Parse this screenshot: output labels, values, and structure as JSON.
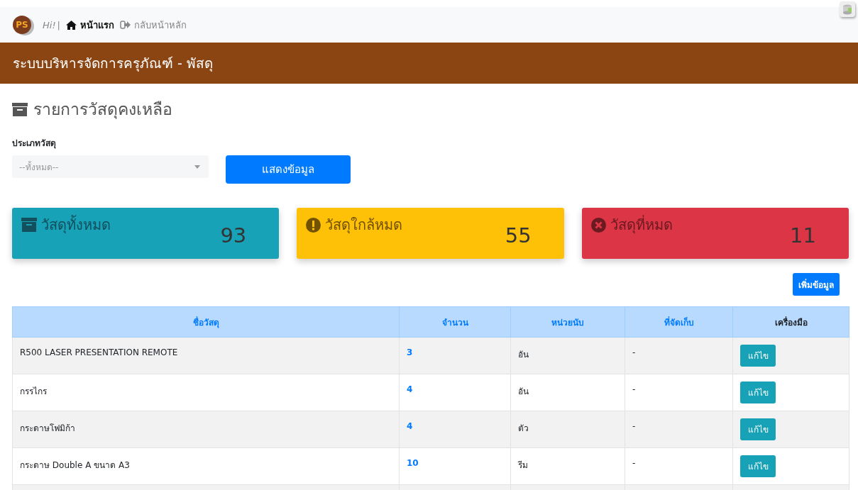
{
  "topbar": {
    "avatar": "PS",
    "greeting": "Hi!",
    "separator": "|",
    "links": [
      {
        "label": "หน้าแรก",
        "kind": "home",
        "bold": true
      },
      {
        "label": "กลับหน้าหลัก",
        "kind": "back",
        "bold": false
      }
    ]
  },
  "banner": {
    "title": "ระบบบริหารจัดการครุภัณฑ์ - พัสดุ"
  },
  "page_title": "รายการวัสดุคงเหลือ",
  "filter": {
    "label": "ประเภทวัสดุ",
    "placeholder": "--ทั้งหมด--",
    "button": "แสดงข้อมูล"
  },
  "cards": [
    {
      "kind": "info",
      "label": "วัสดุทั้งหมด",
      "count": "93"
    },
    {
      "kind": "warning",
      "label": "วัสดุใกล้หมด",
      "count": "55"
    },
    {
      "kind": "danger",
      "label": "วัสดุที่หมด",
      "count": "11"
    }
  ],
  "add_button": "เพิ่มข้อมูล",
  "table": {
    "columns": [
      {
        "label": "ชื่อวัสดุ",
        "sortable": true
      },
      {
        "label": "จำนวน",
        "sortable": true
      },
      {
        "label": "หน่วยนับ",
        "sortable": true
      },
      {
        "label": "ที่จัดเก็บ",
        "sortable": true
      },
      {
        "label": "เครื่องมือ",
        "sortable": false
      }
    ],
    "rows": [
      {
        "name": "R500 LASER PRESENTATION REMOTE",
        "quantity": "3",
        "unit": "อัน",
        "location": "-",
        "action": "แก้ไข"
      },
      {
        "name": "กรรไกร",
        "quantity": "4",
        "unit": "อัน",
        "location": "-",
        "action": "แก้ไข"
      },
      {
        "name": "กระดาษโฟมิก้า",
        "quantity": "4",
        "unit": "ตัว",
        "location": "-",
        "action": "แก้ไข"
      },
      {
        "name": "กระดาษ Double A ขนาด A3",
        "quantity": "10",
        "unit": "รีม",
        "location": "-",
        "action": "แก้ไข"
      }
    ]
  }
}
